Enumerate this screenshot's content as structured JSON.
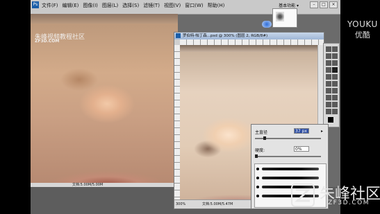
{
  "menu": {
    "app_icon": "Ps",
    "items": [
      "文件(F)",
      "编辑(E)",
      "图像(I)",
      "图层(L)",
      "选择(S)",
      "滤镜(T)",
      "视图(V)",
      "窗口(W)",
      "帮助(H)"
    ],
    "workspace": "基本功能 ▾"
  },
  "left_photo": {
    "watermark_cn": "朱峰视频教程社区",
    "watermark_url": "ZF3D.COM",
    "status": "文档:5.00M/5.00M"
  },
  "doc_window": {
    "title": "罗伯特·帕丁森...psd @ 300% (图层 2, RGB/8#)",
    "zoom": "300%",
    "status": "文档:5.00M/5.47M"
  },
  "brush_panel": {
    "diameter_label": "主直径",
    "diameter_value": "37 px",
    "hardness_label": "硬度:",
    "hardness_value": "0%",
    "diameter_fraction": 0.15,
    "hardness_fraction": 0.0
  },
  "brand": {
    "youku_en": "YOUKU",
    "youku_cn": "优酷",
    "site_cn": "朱峰社区",
    "site_en": "ZF3D.COM"
  },
  "icons": [
    "photoshop-app-icon",
    "minimize-icon",
    "maximize-icon",
    "close-icon",
    "zf3d-logo-icon",
    "brush-tool-icon"
  ]
}
